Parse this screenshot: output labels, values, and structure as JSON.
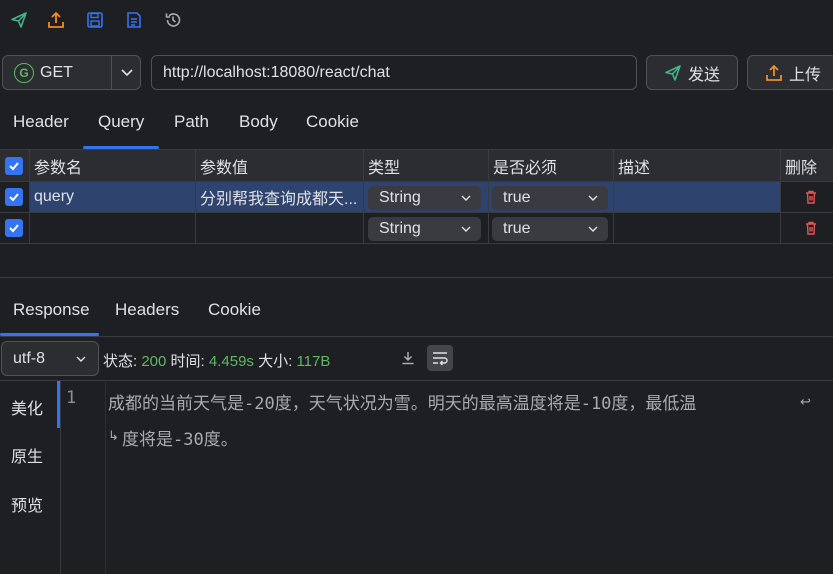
{
  "toolbar": {
    "icons": [
      "send-icon",
      "upload-icon",
      "save-icon",
      "document-list-icon",
      "history-icon"
    ]
  },
  "request": {
    "method": "GET",
    "method_badge": "G",
    "url": "http://localhost:18080/react/chat",
    "send_label": "发送",
    "upload_label": "上传"
  },
  "tabs": [
    "Header",
    "Query",
    "Path",
    "Body",
    "Cookie"
  ],
  "active_tab": "Query",
  "params": {
    "headers": [
      "参数名",
      "参数值",
      "类型",
      "是否必须",
      "描述",
      "删除"
    ],
    "rows": [
      {
        "checked": true,
        "name": "query",
        "value": "分别帮我查询成都天...",
        "type": "String",
        "required": "true",
        "description": ""
      },
      {
        "checked": true,
        "name": "",
        "value": "",
        "type": "String",
        "required": "true",
        "description": ""
      }
    ]
  },
  "response_tabs": [
    "Response",
    "Headers",
    "Cookie"
  ],
  "active_response_tab": "Response",
  "response": {
    "encoding": "utf-8",
    "status_label": "状态:",
    "status_value": "200",
    "time_label": "时间:",
    "time_value": "4.459s",
    "size_label": "大小:",
    "size_value": "117B",
    "view_modes": [
      "美化",
      "原生",
      "预览"
    ],
    "active_view": "美化",
    "line_number": "1",
    "body_line1": "成都的当前天气是-20度，天气状况为雪。明天的最高温度将是-10度，最低温",
    "body_line2": "度将是-30度。"
  },
  "colors": {
    "accent": "#3574f0",
    "success": "#5fb865",
    "danger": "#e55353",
    "icon_green": "#45b386",
    "icon_orange": "#f08c2b",
    "icon_blue": "#3574f0"
  }
}
